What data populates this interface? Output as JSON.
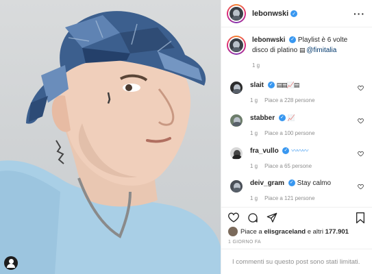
{
  "post": {
    "author": "lebonwski",
    "more_icon": "more-horizontal-icon"
  },
  "caption": {
    "username": "lebonwski",
    "text": "Playlist è 6 volte disco di platino",
    "emoji": "▤",
    "mention": "@fimitalia",
    "age": "1 g"
  },
  "comments": [
    {
      "username": "slait",
      "text": "▤▤📈▤",
      "age": "1 g",
      "likes": "Piace a 228 persone"
    },
    {
      "username": "stabber",
      "text": "📈",
      "age": "1 g",
      "likes": "Piace a 100 persone"
    },
    {
      "username": "fra_vullo",
      "text": "〰〰〰",
      "age": "1 g",
      "likes": "Piace a 65 persone"
    },
    {
      "username": "deiv_gram",
      "text": "Stay calmo",
      "age": "1 g",
      "likes": "Piace a 121 persone"
    }
  ],
  "likes_summary": {
    "prefix": "Piace a",
    "user": "elisgraceland",
    "middle": "e altri",
    "count": "177.901"
  },
  "timestamp": "1 GIORNO FA",
  "comments_disabled": "I commenti su questo post sono stati limitati.",
  "colors": {
    "verified": "#3897f0",
    "muted": "#8e8e8e",
    "link": "#00376b"
  }
}
